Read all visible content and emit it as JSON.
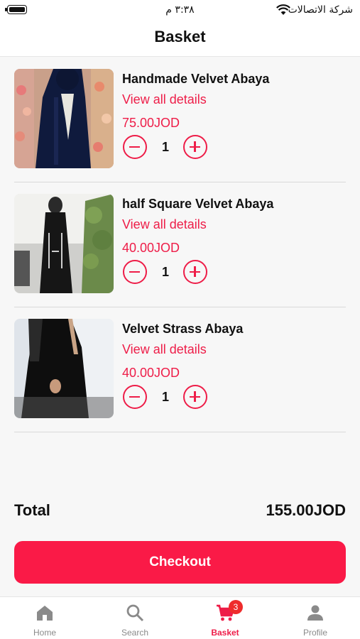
{
  "status_bar": {
    "time": "٣:٣٨ م",
    "carrier": "شركة الاتصالات"
  },
  "header": {
    "title": "Basket"
  },
  "cart": {
    "items": [
      {
        "name": "Handmade Velvet Abaya",
        "details_label": "View all details",
        "price": "75.00JOD",
        "quantity": "1"
      },
      {
        "name": "half Square Velvet Abaya",
        "details_label": "View all details",
        "price": "40.00JOD",
        "quantity": "1"
      },
      {
        "name": "Velvet Strass Abaya",
        "details_label": "View all details",
        "price": "40.00JOD",
        "quantity": "1"
      }
    ]
  },
  "summary": {
    "total_label": "Total",
    "total_value": "155.00JOD"
  },
  "checkout_label": "Checkout",
  "tabbar": {
    "tabs": [
      {
        "label": "Home",
        "icon": "home-icon"
      },
      {
        "label": "Search",
        "icon": "search-icon"
      },
      {
        "label": "Basket",
        "icon": "cart-icon",
        "badge": "3",
        "active": true
      },
      {
        "label": "Profile",
        "icon": "person-icon"
      }
    ]
  },
  "colors": {
    "accent": "#ee1d48",
    "checkout": "#fa1a47",
    "badge": "#ee2c2c",
    "inactive_tab": "#8a8a8a"
  }
}
